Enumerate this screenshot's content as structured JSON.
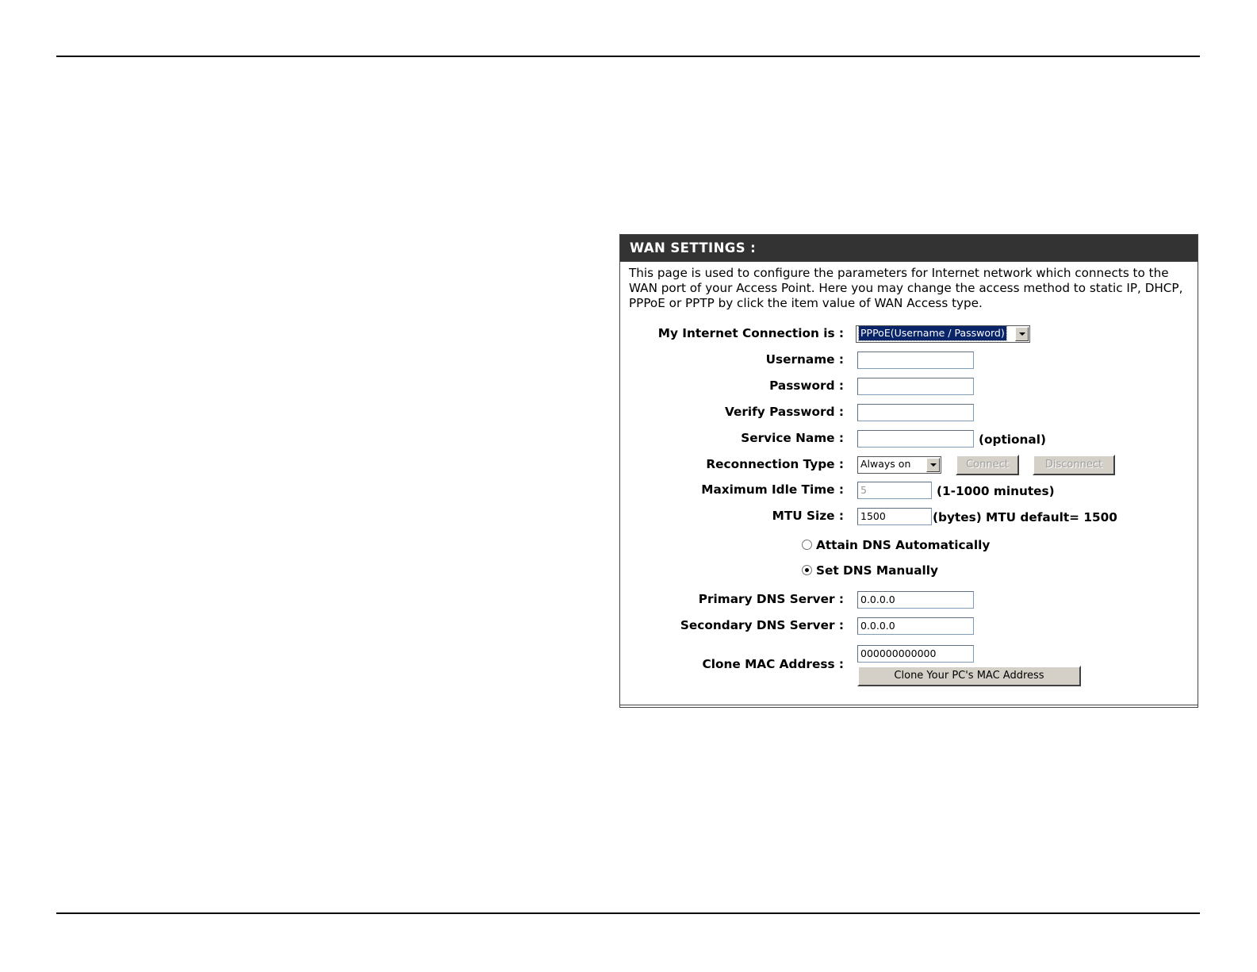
{
  "panel": {
    "title": "WAN SETTINGS :",
    "description": "This page is used to configure the parameters for Internet network which connects to the WAN port of your Access Point. Here you may change the access method to static IP, DHCP, PPPoE or PPTP by click the item value of WAN Access type."
  },
  "form": {
    "connection": {
      "label": "My Internet Connection is :",
      "value": "PPPoE(Username / Password)"
    },
    "username": {
      "label": "Username :",
      "value": ""
    },
    "password": {
      "label": "Password :",
      "value": ""
    },
    "verify_password": {
      "label": "Verify Password :",
      "value": ""
    },
    "service_name": {
      "label": "Service Name :",
      "value": "",
      "suffix": "(optional)"
    },
    "reconnection": {
      "label": "Reconnection Type :",
      "value": "Always on",
      "connect_label": "Connect",
      "disconnect_label": "Disconnect"
    },
    "idle_time": {
      "label": "Maximum Idle Time :",
      "value": "5",
      "suffix": "(1-1000 minutes)"
    },
    "mtu": {
      "label": "MTU Size :",
      "value": "1500",
      "suffix": "(bytes) MTU default= 1500"
    },
    "dns_auto": {
      "label": "Attain DNS Automatically",
      "checked": false
    },
    "dns_manual": {
      "label": "Set DNS Manually",
      "checked": true
    },
    "primary_dns": {
      "label": "Primary DNS Server :",
      "value": "0.0.0.0"
    },
    "secondary_dns": {
      "label": "Secondary DNS Server :",
      "value": "0.0.0.0"
    },
    "clone_mac": {
      "label": "Clone MAC Address :",
      "value": "000000000000",
      "button_label": "Clone Your PC's MAC Address"
    }
  }
}
